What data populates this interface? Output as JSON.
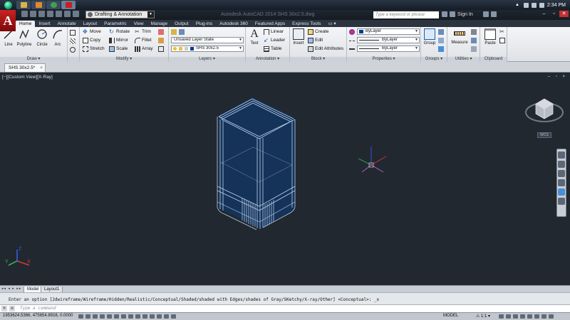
{
  "taskbar": {
    "clock": "2:34 PM",
    "apps": [
      {
        "name": "file-explorer",
        "color": "#d9b44a"
      },
      {
        "name": "media-player",
        "color": "#e08a2c"
      },
      {
        "name": "chrome",
        "color": "#3fa34d"
      },
      {
        "name": "autocad",
        "color": "#c62020"
      }
    ]
  },
  "titlebar": {
    "workspace": "Drafting & Annotation",
    "title": "Autodesk AutoCAD 2014    SHS 30x2.5.dwg",
    "search_placeholder": "Type a keyword or phrase",
    "sign_in": "Sign In"
  },
  "ribbon_tabs": [
    "Home",
    "Insert",
    "Annotate",
    "Layout",
    "Parametric",
    "View",
    "Manage",
    "Output",
    "Plug-ins",
    "Autodesk 360",
    "Featured Apps",
    "Express Tools"
  ],
  "ribbon": {
    "draw": {
      "title": "Draw ▾",
      "line": "Line",
      "polyline": "Polyline",
      "circle": "Circle",
      "arc": "Arc"
    },
    "modify": {
      "title": "Modify ▾",
      "move": "Move",
      "copy": "Copy",
      "stretch": "Stretch",
      "rotate": "Rotate",
      "mirror": "Mirror",
      "scale": "Scale",
      "trim": "Trim",
      "fillet": "Fillet",
      "array": "Array"
    },
    "layers": {
      "title": "Layers ▾",
      "layer_state": "Unsaved Layer State",
      "current_layer": "SHS 30x2.5"
    },
    "annotation": {
      "title": "Annotation ▾",
      "text": "Text",
      "linear": "Linear",
      "leader": "Leader",
      "table": "Table"
    },
    "block": {
      "title": "Block ▾",
      "insert": "Insert",
      "create": "Create",
      "edit": "Edit",
      "edit_attributes": "Edit Attributes"
    },
    "properties": {
      "title": "Properties ▾",
      "color": "ByLayer",
      "linetype": "ByLayer",
      "lineweight": "ByLayer"
    },
    "groups": {
      "title": "Groups ▾",
      "group": "Group"
    },
    "utilities": {
      "title": "Utilities ▾",
      "measure": "Measure"
    },
    "clipboard": {
      "title": "Clipboard",
      "paste": "Paste"
    }
  },
  "file_tab": "SHS 30x2.5*",
  "viewport": {
    "label": "[−][Custom View][X-Ray]",
    "controls": "– ▫ ×",
    "wcs": "WCS"
  },
  "layout_tabs": {
    "nav": "◂◂ ◂ ▸ ▸▸",
    "model": "Model",
    "layout1": "Layout1"
  },
  "command": {
    "history": "Enter an option [2dwireframe/Wireframe/Hidden/Realistic/Conceptual/Shaded/shaded with Edges/shades of Gray/SKetchy/X-ray/Other] <Conceptual>: _x",
    "placeholder": "Type a command"
  },
  "status": {
    "coords": "1953624.5366, 475654.8916, 0.0000",
    "model": "MODEL",
    "scale": "⚠ 1:1 ▾"
  }
}
